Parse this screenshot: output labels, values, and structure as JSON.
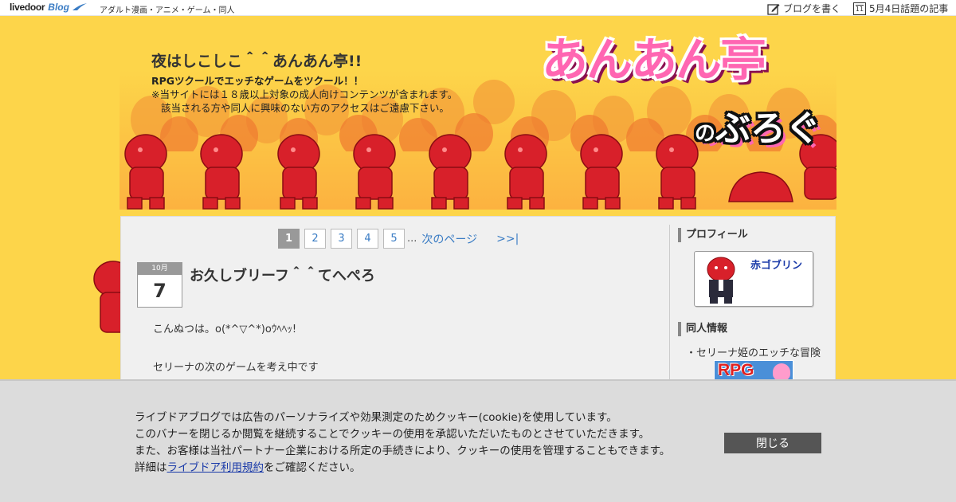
{
  "topbar": {
    "brand_main": "livedoor",
    "brand_blog": "Blog",
    "category": "アダルト漫画・アニメ・ゲーム・同人",
    "write_label": "ブログを書く",
    "calendar_day": "11",
    "trending_label": "5月4日話題の記事"
  },
  "header": {
    "title": "夜はしこしこ＾＾あんあん亭!!",
    "desc1": "RPGツクールでエッチなゲームをツクール！！",
    "desc2": "※当サイトには１８歳以上対象の成人向けコンテンツが含まれます。",
    "desc3": "該当される方や同人に興味のない方のアクセスはご遠慮下さい。",
    "logo_main": "あんあん亭",
    "logo_no": "の",
    "logo_sub": "ぶろぐ"
  },
  "pager": {
    "pages": [
      "1",
      "2",
      "3",
      "4",
      "5"
    ],
    "dots": "...",
    "next": "次のページ",
    "last": ">>|"
  },
  "post": {
    "month": "10月",
    "day": "7",
    "title": "お久しブリーフ＾＾てへぺろ",
    "lines": [
      "こんぬつは。o(*^▽^*)oｳﾍﾍｯ!",
      "",
      "セリーナの次のゲームを考え中です"
    ]
  },
  "sidebar": {
    "profile_heading": "プロフィール",
    "profile_name": "赤ゴブリン",
    "doujin_heading": "同人情報",
    "doujin_item": "・セリーナ姫のエッチな冒険",
    "banner_text": "RPG"
  },
  "cookie": {
    "line1": "ライブドアブログでは広告のパーソナライズや効果測定のためクッキー(cookie)を使用しています。",
    "line2": "このバナーを閉じるか閲覧を継続することでクッキーの使用を承認いただいたものとさせていただきます。",
    "line3": "また、お客様は当社パートナー企業における所定の手続きにより、クッキーの使用を管理することもできます。",
    "line4_prefix": "詳細は",
    "line4_link": "ライブドア利用規約",
    "line4_suffix": "をご確認ください。",
    "close_label": "閉じる"
  },
  "colors": {
    "background": "#fdd54a",
    "link": "#3a7cc4",
    "goblin_red": "#d8202a",
    "logo_pink": "#ff66b2"
  }
}
